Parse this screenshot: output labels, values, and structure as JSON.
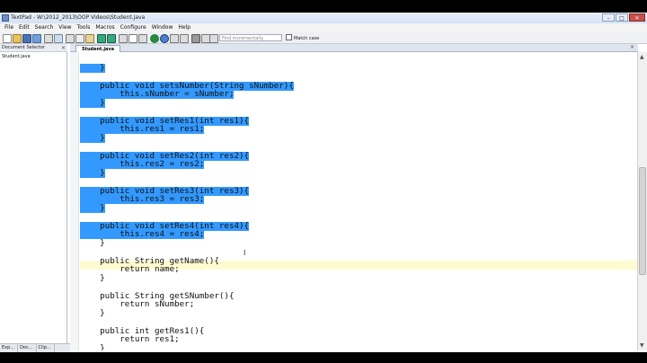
{
  "window": {
    "title": "TextPad - W:\\2012_2013\\OOP Videos\\Student.java"
  },
  "menu": [
    "File",
    "Edit",
    "Search",
    "View",
    "Tools",
    "Macros",
    "Configure",
    "Window",
    "Help"
  ],
  "toolbar": {
    "find_placeholder": "Find incrementally",
    "match_case_label": "Match case"
  },
  "document_selector": {
    "title": "Document Selector",
    "files": [
      "Student.java"
    ]
  },
  "side_tabs": [
    "Exp...",
    "Doc...",
    "Clip..."
  ],
  "editor_tab": {
    "label": "Student.java"
  },
  "code_lines": [
    {
      "text": "    }",
      "selected": true
    },
    {
      "text": "",
      "selected": true
    },
    {
      "text": "    public void setsNumber(String sNumber){",
      "selected": true
    },
    {
      "text": "        this.sNumber = sNumber;",
      "selected": true
    },
    {
      "text": "    }",
      "selected": true
    },
    {
      "text": "",
      "selected": true
    },
    {
      "text": "    public void setRes1(int res1){",
      "selected": true
    },
    {
      "text": "        this.res1 = res1;",
      "selected": true
    },
    {
      "text": "    }",
      "selected": true
    },
    {
      "text": "",
      "selected": true
    },
    {
      "text": "    public void setRes2(int res2){",
      "selected": true
    },
    {
      "text": "        this.res2 = res2;",
      "selected": true
    },
    {
      "text": "    }",
      "selected": true
    },
    {
      "text": "",
      "selected": true
    },
    {
      "text": "    public void setRes3(int res3){",
      "selected": true
    },
    {
      "text": "        this.res3 = res3;",
      "selected": true
    },
    {
      "text": "    }",
      "selected": true
    },
    {
      "text": "",
      "selected": true
    },
    {
      "text": "    public void setRes4(int res4){",
      "selected": true
    },
    {
      "text": "        this.res4 = res4;",
      "selected": true
    },
    {
      "text": "    }",
      "selected": false
    },
    {
      "text": "",
      "selected": false
    },
    {
      "text": "    public String getName(){",
      "selected": false
    },
    {
      "text": "        return name;",
      "selected": false
    },
    {
      "text": "    }",
      "selected": false
    },
    {
      "text": "",
      "selected": false
    },
    {
      "text": "    public String getSNumber(){",
      "selected": false
    },
    {
      "text": "        return sNumber;",
      "selected": false
    },
    {
      "text": "    }",
      "selected": false
    },
    {
      "text": "",
      "selected": false
    },
    {
      "text": "    public int getRes1(){",
      "selected": false
    },
    {
      "text": "        return res1;",
      "selected": false
    },
    {
      "text": "    }",
      "selected": false
    }
  ],
  "colors": {
    "selection": "#3399ff",
    "current_line": "#fffbd0"
  }
}
